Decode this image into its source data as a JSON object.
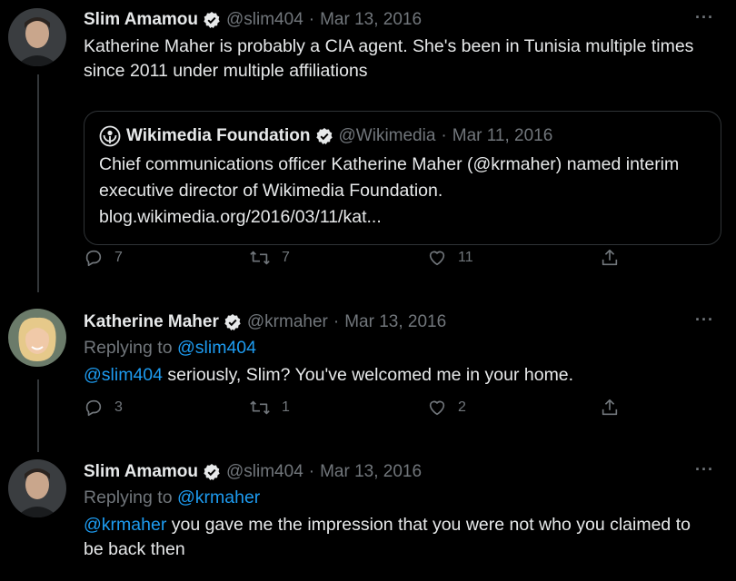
{
  "tweets": [
    {
      "author": "Slim Amamou",
      "handle": "@slim404",
      "separator": "·",
      "date": "Mar 13, 2016",
      "more": "···",
      "text": "Katherine Maher is probably a CIA agent. She's been in Tunisia multiple times since 2011 under multiple affiliations",
      "quote": {
        "author": "Wikimedia Foundation",
        "handle": "@Wikimedia",
        "separator": "·",
        "date": "Mar 11, 2016",
        "text": "Chief communications officer Katherine Maher (@krmaher) named interim executive director of Wikimedia Foundation.",
        "link": "blog.wikimedia.org/2016/03/11/kat..."
      },
      "actions": {
        "replies": "7",
        "retweets": "7",
        "likes": "11"
      }
    },
    {
      "author": "Katherine Maher",
      "handle": "@krmaher",
      "separator": "·",
      "date": "Mar 13, 2016",
      "more": "···",
      "replying_prefix": "Replying to",
      "replying_to": "@slim404",
      "mention": "@slim404",
      "text": " seriously, Slim? You've welcomed me in your home.",
      "actions": {
        "replies": "3",
        "retweets": "1",
        "likes": "2"
      }
    },
    {
      "author": "Slim Amamou",
      "handle": "@slim404",
      "separator": "·",
      "date": "Mar 13, 2016",
      "more": "···",
      "replying_prefix": "Replying to",
      "replying_to": "@krmaher",
      "mention": "@krmaher",
      "text": " you gave me the impression that you were not who you claimed to be back then"
    }
  ],
  "colors": {
    "background": "#000000",
    "text": "#e7e9ea",
    "muted": "#71767b",
    "link": "#1d9bf0",
    "border": "#2f3336"
  },
  "icons": [
    "verified-badge-icon",
    "reply-icon",
    "retweet-icon",
    "like-icon",
    "share-icon",
    "wikimedia-logo-icon"
  ]
}
